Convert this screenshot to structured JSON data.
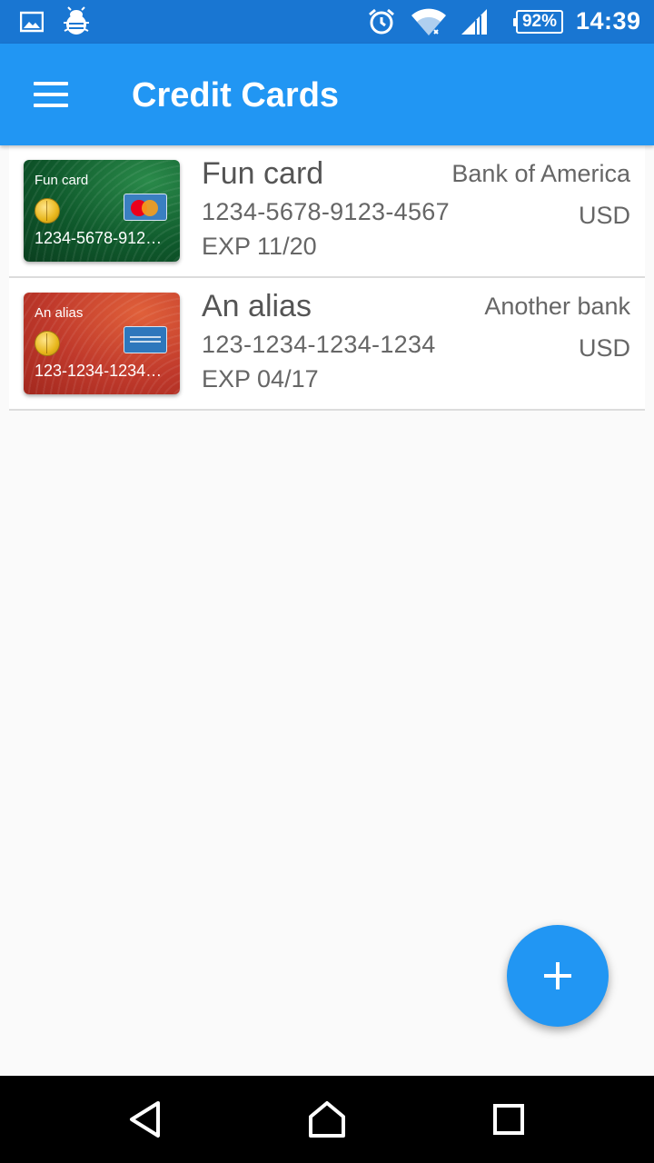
{
  "status_bar": {
    "battery_level": "92%",
    "time": "14:39",
    "icons": [
      "gallery-icon",
      "debug-bug-icon",
      "alarm-icon",
      "wifi-icon",
      "cell-signal-icon"
    ]
  },
  "app_bar": {
    "title": "Credit Cards",
    "menu_icon": "hamburger-menu-icon"
  },
  "cards": [
    {
      "alias": "Fun card",
      "thumb_alias": "Fun card",
      "thumb_number": "1234-5678-912…",
      "number": "1234-5678-9123-4567",
      "expiry": "EXP 11/20",
      "bank": "Bank of America",
      "currency": "USD",
      "network": "mastercard",
      "color": "#0f5a2c"
    },
    {
      "alias": "An alias",
      "thumb_alias": "An alias",
      "thumb_number": "123-1234-1234…",
      "number": "123-1234-1234-1234",
      "expiry": "EXP 04/17",
      "bank": "Another bank",
      "currency": "USD",
      "network": "american-express",
      "color": "#c0392b"
    }
  ],
  "fab": {
    "icon": "plus-icon",
    "color": "#2196f3"
  },
  "nav_bar": {
    "icons": [
      "back-icon",
      "home-icon",
      "recents-icon"
    ]
  },
  "colors": {
    "status_bar": "#1976d2",
    "app_bar": "#2196f3",
    "background": "#fafafa"
  }
}
